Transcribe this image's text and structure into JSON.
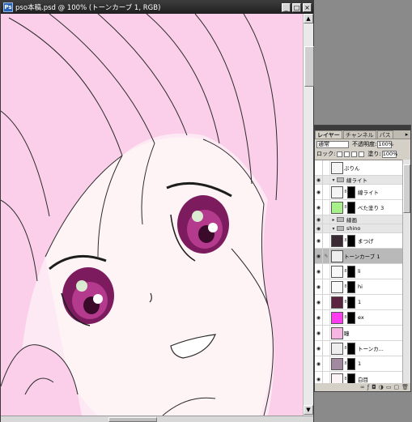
{
  "document": {
    "title": "pso本稿.psd @ 100% (トーンカーブ 1, RGB)",
    "app_icon": "Ps",
    "buttons": {
      "minimize": "_",
      "maximize": "□",
      "close": "×"
    },
    "scroll_up": "▲",
    "scroll_down": "▼"
  },
  "panel": {
    "tabs": [
      "レイヤー",
      "チャンネル",
      "パス"
    ],
    "menu_icon": "▸",
    "blend_mode": "通常",
    "opacity_label": "不透明度:",
    "opacity_value": "100%",
    "lock_label": "ロック:",
    "fill_label": "塗り:",
    "fill_value": "100%",
    "footer_icons": [
      "link-icon",
      "fx-icon",
      "mask-icon",
      "adjustment-icon",
      "group-icon",
      "new-layer-icon",
      "trash-icon"
    ],
    "footer_glyphs": [
      "∞",
      "ƒ",
      "◘",
      "◑",
      "▭",
      "▢",
      "🗑"
    ],
    "layers": [
      {
        "name": "ぷりん",
        "kind": "layer",
        "visible": false,
        "thumb": "#f5f5f5",
        "mask": false
      },
      {
        "name": "線ライト",
        "kind": "group",
        "visible": true,
        "expanded": true
      },
      {
        "name": "線ライト",
        "kind": "layer",
        "visible": true,
        "thumb": "#f4f4f4",
        "mask": true
      },
      {
        "name": "べた塗り 3",
        "kind": "layer",
        "visible": true,
        "thumb": "#a8f08a",
        "mask": true
      },
      {
        "name": "線画",
        "kind": "group",
        "visible": true,
        "expanded": false
      },
      {
        "name": "shino",
        "kind": "group",
        "visible": true,
        "expanded": true
      },
      {
        "name": "まつげ",
        "kind": "layer",
        "visible": true,
        "thumb": "#3a2a33",
        "mask": true
      },
      {
        "name": "トーンカーブ 1",
        "kind": "adjustment",
        "visible": true,
        "thumb": "#eeeeee",
        "mask": false,
        "selected": true
      },
      {
        "name": "li",
        "kind": "layer",
        "visible": true,
        "thumb": "#f8f8f8",
        "mask": true
      },
      {
        "name": "hi",
        "kind": "layer",
        "visible": true,
        "thumb": "#f8f8f8",
        "mask": true
      },
      {
        "name": "1",
        "kind": "layer",
        "visible": true,
        "thumb": "#5a2440",
        "mask": true
      },
      {
        "name": "ex",
        "kind": "layer",
        "visible": true,
        "thumb": "#ff3cf2",
        "mask": true
      },
      {
        "name": "瞳",
        "kind": "layer",
        "visible": true,
        "thumb": "#f7b6e2",
        "mask": false
      },
      {
        "name": "トーンカ...",
        "kind": "adjustment",
        "visible": true,
        "thumb": "#eeeeee",
        "mask": true
      },
      {
        "name": "1",
        "kind": "layer",
        "visible": true,
        "thumb": "#a18aa0",
        "mask": true
      },
      {
        "name": "白目",
        "kind": "layer",
        "visible": true,
        "thumb": "#fbf3f6",
        "mask": true
      }
    ]
  }
}
